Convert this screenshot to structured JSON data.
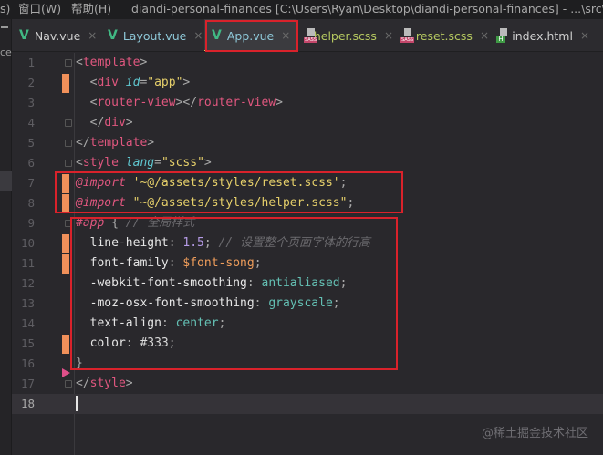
{
  "titlebar": {
    "menu_prefix": "s)",
    "menu_window": "窗口(W)",
    "menu_help": "帮助(H)",
    "title": "diandi-personal-finances [C:\\Users\\Ryan\\Desktop\\diandi-personal-finances] - ...\\src\\App.vue"
  },
  "sidebar": {
    "label": "ce"
  },
  "tabs": [
    {
      "label": "Nav.vue",
      "icon": "vue-icon",
      "active": false
    },
    {
      "label": "Layout.vue",
      "icon": "vue-icon",
      "active": false
    },
    {
      "label": "App.vue",
      "icon": "vue-icon",
      "active": true
    },
    {
      "label": "helper.scss",
      "icon": "sass-icon",
      "active": false
    },
    {
      "label": "reset.scss",
      "icon": "sass-icon",
      "active": false
    },
    {
      "label": "index.html",
      "icon": "html-icon",
      "active": false
    }
  ],
  "close_glyph": "×",
  "colors": {
    "highlight_box": "#d9222b",
    "active_tab_underline": "#e8c35a",
    "change_marker": "#f0905a"
  },
  "lines": [
    {
      "n": "1",
      "tokens": [
        [
          "<",
          "p"
        ],
        [
          "template",
          "tag"
        ],
        [
          ">",
          "p"
        ]
      ]
    },
    {
      "n": "2",
      "tokens": [
        [
          "  ",
          "p"
        ],
        [
          "<",
          "p"
        ],
        [
          "div ",
          "tag"
        ],
        [
          "id",
          "attr"
        ],
        [
          "=",
          "p"
        ],
        [
          "\"app\"",
          "str"
        ],
        [
          ">",
          "p"
        ]
      ]
    },
    {
      "n": "3",
      "tokens": [
        [
          "  ",
          "p"
        ],
        [
          "<",
          "p"
        ],
        [
          "router-view",
          "tag"
        ],
        [
          "></",
          "p"
        ],
        [
          "router-view",
          "tag"
        ],
        [
          ">",
          "p"
        ]
      ]
    },
    {
      "n": "4",
      "tokens": [
        [
          "  ",
          "p"
        ],
        [
          "</",
          "p"
        ],
        [
          "div",
          "tag"
        ],
        [
          ">",
          "p"
        ]
      ]
    },
    {
      "n": "5",
      "tokens": [
        [
          "</",
          "p"
        ],
        [
          "template",
          "tag"
        ],
        [
          ">",
          "p"
        ]
      ]
    },
    {
      "n": "6",
      "tokens": [
        [
          "<",
          "p"
        ],
        [
          "style ",
          "tag"
        ],
        [
          "lang",
          "attr"
        ],
        [
          "=",
          "p"
        ],
        [
          "\"scss\"",
          "str"
        ],
        [
          ">",
          "p"
        ]
      ]
    },
    {
      "n": "7",
      "tokens": [
        [
          "@import",
          "kw"
        ],
        [
          " ",
          "p"
        ],
        [
          "'~@/assets/styles/reset.scss'",
          "str"
        ],
        [
          ";",
          "p"
        ]
      ]
    },
    {
      "n": "8",
      "tokens": [
        [
          "@import",
          "kw"
        ],
        [
          " ",
          "p"
        ],
        [
          "\"~@/assets/styles/helper.scss\"",
          "str"
        ],
        [
          ";",
          "p"
        ]
      ]
    },
    {
      "n": "9",
      "tokens": [
        [
          "#app",
          "sel"
        ],
        [
          " { ",
          "p"
        ],
        [
          "// 全局样式",
          "com"
        ]
      ]
    },
    {
      "n": "10",
      "tokens": [
        [
          "  ",
          "p"
        ],
        [
          "line-height",
          "prop"
        ],
        [
          ": ",
          "p"
        ],
        [
          "1.5",
          "num"
        ],
        [
          "; ",
          "p"
        ],
        [
          "// 设置整个页面字体的行高",
          "com"
        ]
      ]
    },
    {
      "n": "11",
      "tokens": [
        [
          "  ",
          "p"
        ],
        [
          "font-family",
          "prop"
        ],
        [
          ": ",
          "p"
        ],
        [
          "$font-song",
          "var"
        ],
        [
          ";",
          "p"
        ]
      ]
    },
    {
      "n": "12",
      "tokens": [
        [
          "  ",
          "p"
        ],
        [
          "-webkit-font-smoothing",
          "prop"
        ],
        [
          ": ",
          "p"
        ],
        [
          "antialiased",
          "val"
        ],
        [
          ";",
          "p"
        ]
      ]
    },
    {
      "n": "13",
      "tokens": [
        [
          "  ",
          "p"
        ],
        [
          "-moz-osx-font-smoothing",
          "prop"
        ],
        [
          ": ",
          "p"
        ],
        [
          "grayscale",
          "val"
        ],
        [
          ";",
          "p"
        ]
      ]
    },
    {
      "n": "14",
      "tokens": [
        [
          "  ",
          "p"
        ],
        [
          "text-align",
          "prop"
        ],
        [
          ": ",
          "p"
        ],
        [
          "center",
          "val"
        ],
        [
          ";",
          "p"
        ]
      ]
    },
    {
      "n": "15",
      "tokens": [
        [
          "  ",
          "p"
        ],
        [
          "color",
          "prop"
        ],
        [
          ": ",
          "p"
        ],
        [
          "#333",
          "txt"
        ],
        [
          ";",
          "p"
        ]
      ]
    },
    {
      "n": "16",
      "tokens": [
        [
          "}",
          "p"
        ]
      ]
    },
    {
      "n": "17",
      "tokens": [
        [
          "</",
          "p"
        ],
        [
          "style",
          "tag"
        ],
        [
          ">",
          "p"
        ]
      ]
    },
    {
      "n": "18",
      "tokens": []
    }
  ],
  "watermark": "@稀土掘金技术社区"
}
